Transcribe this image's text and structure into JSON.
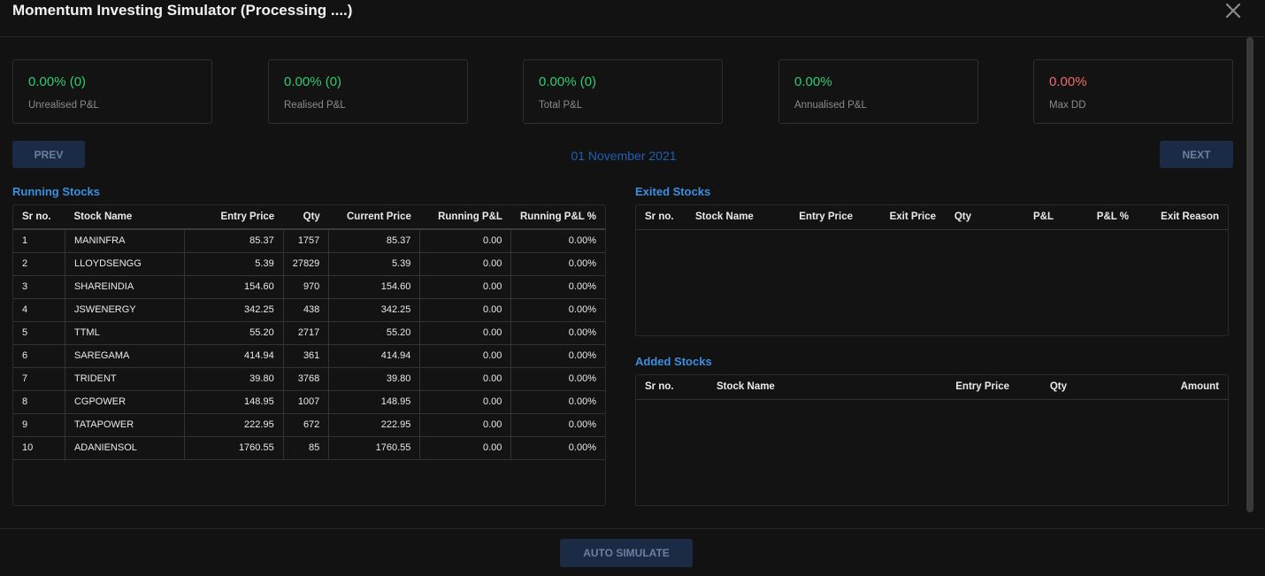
{
  "window": {
    "title": "Momentum Investing Simulator (Processing ....)"
  },
  "summary": [
    {
      "value": "0.00% (0)",
      "label": "Unrealised P&L",
      "tone": "green"
    },
    {
      "value": "0.00% (0)",
      "label": "Realised P&L",
      "tone": "green"
    },
    {
      "value": "0.00% (0)",
      "label": "Total P&L",
      "tone": "green"
    },
    {
      "value": "0.00%",
      "label": "Annualised P&L",
      "tone": "green"
    },
    {
      "value": "0.00%",
      "label": "Max DD",
      "tone": "red"
    }
  ],
  "nav": {
    "prev_label": "PREV",
    "next_label": "NEXT",
    "date": "01 November 2021"
  },
  "running": {
    "title": "Running Stocks",
    "columns": [
      "Sr no.",
      "Stock Name",
      "Entry Price",
      "Qty",
      "Current Price",
      "Running P&L",
      "Running P&L %"
    ],
    "rows": [
      [
        "1",
        "MANINFRA",
        "85.37",
        "1757",
        "85.37",
        "0.00",
        "0.00%"
      ],
      [
        "2",
        "LLOYDSENGG",
        "5.39",
        "27829",
        "5.39",
        "0.00",
        "0.00%"
      ],
      [
        "3",
        "SHAREINDIA",
        "154.60",
        "970",
        "154.60",
        "0.00",
        "0.00%"
      ],
      [
        "4",
        "JSWENERGY",
        "342.25",
        "438",
        "342.25",
        "0.00",
        "0.00%"
      ],
      [
        "5",
        "TTML",
        "55.20",
        "2717",
        "55.20",
        "0.00",
        "0.00%"
      ],
      [
        "6",
        "SAREGAMA",
        "414.94",
        "361",
        "414.94",
        "0.00",
        "0.00%"
      ],
      [
        "7",
        "TRIDENT",
        "39.80",
        "3768",
        "39.80",
        "0.00",
        "0.00%"
      ],
      [
        "8",
        "CGPOWER",
        "148.95",
        "1007",
        "148.95",
        "0.00",
        "0.00%"
      ],
      [
        "9",
        "TATAPOWER",
        "222.95",
        "672",
        "222.95",
        "0.00",
        "0.00%"
      ],
      [
        "10",
        "ADANIENSOL",
        "1760.55",
        "85",
        "1760.55",
        "0.00",
        "0.00%"
      ]
    ]
  },
  "exited": {
    "title": "Exited Stocks",
    "columns": [
      "Sr no.",
      "Stock Name",
      "Entry Price",
      "Exit Price",
      "Qty",
      "P&L",
      "P&L %",
      "Exit Reason"
    ]
  },
  "added": {
    "title": "Added Stocks",
    "columns": [
      "Sr no.",
      "Stock Name",
      "Entry Price",
      "Qty",
      "Amount"
    ]
  },
  "footer": {
    "auto_simulate_label": "AUTO SIMULATE"
  },
  "colors": {
    "green": "#2ecc71",
    "red": "#ef6a6a",
    "accent": "#3b8fe0",
    "button_bg": "#1b2b45"
  },
  "icons": {
    "close": "close-icon"
  }
}
